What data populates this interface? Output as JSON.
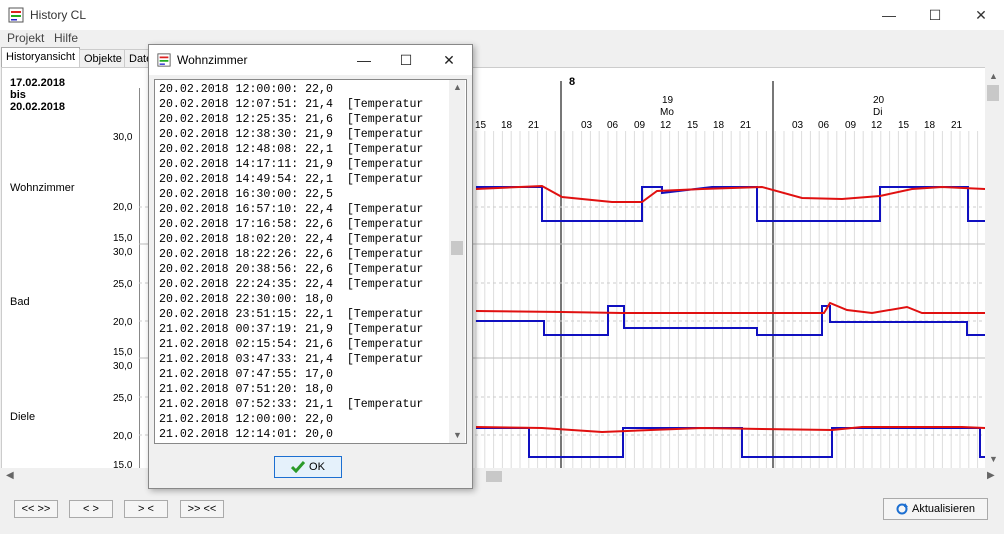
{
  "app": {
    "title": "History CL"
  },
  "window_controls": {
    "minimize": "—",
    "maximize": "☐",
    "close": "✕"
  },
  "menu": [
    {
      "label": "Projekt"
    },
    {
      "label": "Hilfe"
    }
  ],
  "tabs": [
    {
      "label": "Historyansicht"
    },
    {
      "label": "Objekte"
    },
    {
      "label": "Date"
    }
  ],
  "date_range": {
    "from": "17.02.2018",
    "bis": "bis",
    "to": "20.02.2018"
  },
  "rows": [
    {
      "label": "Wohnzimmer",
      "ticks": [
        "30,0",
        "20,0",
        "15,0"
      ]
    },
    {
      "label": "Bad",
      "ticks": [
        "30,0",
        "25,0",
        "20,0",
        "15,0"
      ]
    },
    {
      "label": "Diele",
      "ticks": [
        "30,0",
        "25,0",
        "20,0",
        "15,0"
      ]
    }
  ],
  "timeline": {
    "day_markers": [
      {
        "label": "8"
      },
      {
        "day": "19",
        "weekday": "Mo"
      },
      {
        "day": "20",
        "weekday": "Di"
      }
    ],
    "hours": [
      "15",
      "18",
      "21",
      "03",
      "06",
      "09",
      "12",
      "15",
      "18",
      "21",
      "03",
      "06",
      "09",
      "12",
      "15",
      "18",
      "21"
    ]
  },
  "nav_buttons": [
    {
      "label": "<< >>"
    },
    {
      "label": "< >"
    },
    {
      "label": "> <"
    },
    {
      "label": ">> <<"
    }
  ],
  "refresh_button": {
    "label": "Aktualisieren"
  },
  "dialog": {
    "title": "Wohnzimmer",
    "ok_label": "OK",
    "lines": [
      "20.02.2018 12:00:00: 22,0",
      "20.02.2018 12:07:51: 21,4  [Temperatur",
      "20.02.2018 12:25:35: 21,6  [Temperatur",
      "20.02.2018 12:38:30: 21,9  [Temperatur",
      "20.02.2018 12:48:08: 22,1  [Temperatur",
      "20.02.2018 14:17:11: 21,9  [Temperatur",
      "20.02.2018 14:49:54: 22,1  [Temperatur",
      "20.02.2018 16:30:00: 22,5",
      "20.02.2018 16:57:10: 22,4  [Temperatur",
      "20.02.2018 17:16:58: 22,6  [Temperatur",
      "20.02.2018 18:02:20: 22,4  [Temperatur",
      "20.02.2018 18:22:26: 22,6  [Temperatur",
      "20.02.2018 20:38:56: 22,6  [Temperatur",
      "20.02.2018 22:24:35: 22,4  [Temperatur",
      "20.02.2018 22:30:00: 18,0",
      "20.02.2018 23:51:15: 22,1  [Temperatur",
      "21.02.2018 00:37:19: 21,9  [Temperatur",
      "21.02.2018 02:15:54: 21,6  [Temperatur",
      "21.02.2018 03:47:33: 21,4  [Temperatur",
      "21.02.2018 07:47:55: 17,0",
      "21.02.2018 07:51:20: 18,0",
      "21.02.2018 07:52:33: 21,1  [Temperatur",
      "21.02.2018 12:00:00: 22,0",
      "21.02.2018 12:14:01: 20,0"
    ]
  },
  "colors": {
    "actual": "#e01010",
    "setpoint": "#1010c0",
    "accent": "#1c6fd1"
  }
}
